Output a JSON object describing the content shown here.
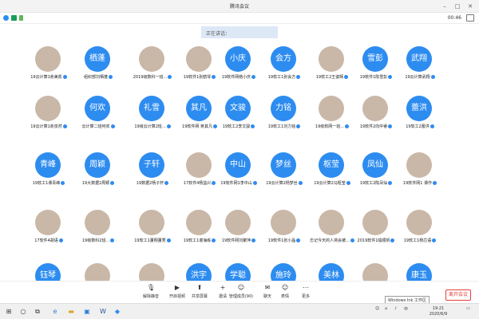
{
  "window": {
    "title": "腾讯会议"
  },
  "status": {
    "time": "00:46"
  },
  "speaking": {
    "label": "正在讲话："
  },
  "grid": {
    "rows": [
      [
        {
          "text": "",
          "kind": "photo",
          "name": "19云计算1俞美凯"
        },
        {
          "text": "栖蓬",
          "kind": "blue",
          "name": "组织部刘栖蓬"
        },
        {
          "text": "",
          "kind": "photo",
          "name": "2019级数科一班..."
        },
        {
          "text": "",
          "kind": "photo",
          "name": "19软件1张鹤琴"
        },
        {
          "text": "小庆",
          "kind": "blue",
          "name": "19软件网络小庆"
        },
        {
          "text": "会方",
          "kind": "blue",
          "name": "19软工1张会方"
        },
        {
          "text": "",
          "kind": "photo",
          "name": "19软工2王姿辉"
        },
        {
          "text": "雪彭",
          "kind": "blue",
          "name": "19软件1陈雪彭"
        },
        {
          "text": "武翔",
          "kind": "blue",
          "name": "19云计算武翔"
        }
      ],
      [
        {
          "text": "",
          "kind": "photo",
          "name": "19云计算1俞泉然"
        },
        {
          "text": "何欢",
          "kind": "blue",
          "name": "云计算二班何欢"
        },
        {
          "text": "礼雪",
          "kind": "blue",
          "name": "19级云计算2班..."
        },
        {
          "text": "其凡",
          "kind": "blue",
          "name": "19软件网 蒋其凡"
        },
        {
          "text": "文骏",
          "kind": "blue",
          "name": "19软工2李文骏"
        },
        {
          "text": "力铭",
          "kind": "blue",
          "name": "19软工1刘力铭"
        },
        {
          "text": "",
          "kind": "photo",
          "name": "19级软网一班..."
        },
        {
          "text": "",
          "kind": "photo",
          "name": "19软件2向中睿"
        },
        {
          "text": "蕾洪",
          "kind": "blue",
          "name": "19软工2蕾洪"
        }
      ],
      [
        {
          "text": "青峰",
          "kind": "blue",
          "name": "19软工1谭青峰"
        },
        {
          "text": "周颖",
          "kind": "blue",
          "name": "19大数据2周颖"
        },
        {
          "text": "子轩",
          "kind": "blue",
          "name": "19数据2杨子轩"
        },
        {
          "text": "",
          "kind": "photo",
          "name": "17软件4杨益兴"
        },
        {
          "text": "中山",
          "kind": "blue",
          "name": "19软件网1李中山"
        },
        {
          "text": "梦丝",
          "kind": "blue",
          "name": "19云计算2杨梦丝"
        },
        {
          "text": "枢莹",
          "kind": "blue",
          "name": "19云计算2马枢莹"
        },
        {
          "text": "凤仙",
          "kind": "blue",
          "name": "19软工2陈凤仙"
        },
        {
          "text": "",
          "kind": "photo",
          "name": "19软件网1 谭作"
        }
      ],
      [
        {
          "text": "",
          "kind": "photo",
          "name": "17软件4胡语"
        },
        {
          "text": "",
          "kind": "photo",
          "name": "19级数科2班..."
        },
        {
          "text": "",
          "kind": "photo",
          "name": "19软工1董翔董秀"
        },
        {
          "text": "",
          "kind": "photo",
          "name": "19软工1谢海栋"
        },
        {
          "text": "",
          "kind": "photo",
          "name": "19软件网刘聚萍"
        },
        {
          "text": "",
          "kind": "photo",
          "name": "19软件1张小晶"
        },
        {
          "text": "",
          "kind": "photo",
          "name": "忘记今天的人将会被..."
        },
        {
          "text": "",
          "kind": "photo",
          "name": "2019软件1喻顺帆"
        },
        {
          "text": "",
          "kind": "photo",
          "name": "19软工1杨芯语"
        }
      ],
      [
        {
          "text": "钰琴",
          "kind": "blue",
          "name": ""
        },
        {
          "text": "",
          "kind": "photo",
          "name": ""
        },
        {
          "text": "",
          "kind": "photo",
          "name": ""
        },
        {
          "text": "洪宇",
          "kind": "blue",
          "name": ""
        },
        {
          "text": "学聪",
          "kind": "blue",
          "name": ""
        },
        {
          "text": "施玲",
          "kind": "blue",
          "name": ""
        },
        {
          "text": "美林",
          "kind": "blue",
          "name": ""
        },
        {
          "text": "",
          "kind": "photo",
          "name": ""
        },
        {
          "text": "康玉",
          "kind": "blue",
          "name": ""
        }
      ]
    ]
  },
  "toolbar": {
    "items": [
      {
        "label": "解除静音",
        "icon": "microphone-icon"
      },
      {
        "label": "开启视频",
        "icon": "camera-icon"
      },
      {
        "label": "共享屏幕",
        "icon": "share-screen-icon"
      },
      {
        "label": "邀请",
        "icon": "invite-icon"
      },
      {
        "label": "管理成员(90)",
        "icon": "members-icon"
      },
      {
        "label": "聊天",
        "icon": "chat-icon"
      },
      {
        "label": "表情",
        "icon": "emoji-icon"
      },
      {
        "label": "更多",
        "icon": "more-icon"
      }
    ],
    "leave_label": "离开会议"
  },
  "taskbar": {
    "time": "19:21",
    "date": "2020/6/9",
    "tooltip": "Windows Ink 工作区"
  },
  "colors": {
    "accent": "#2d8cf0",
    "leave": "#e43d3d"
  }
}
